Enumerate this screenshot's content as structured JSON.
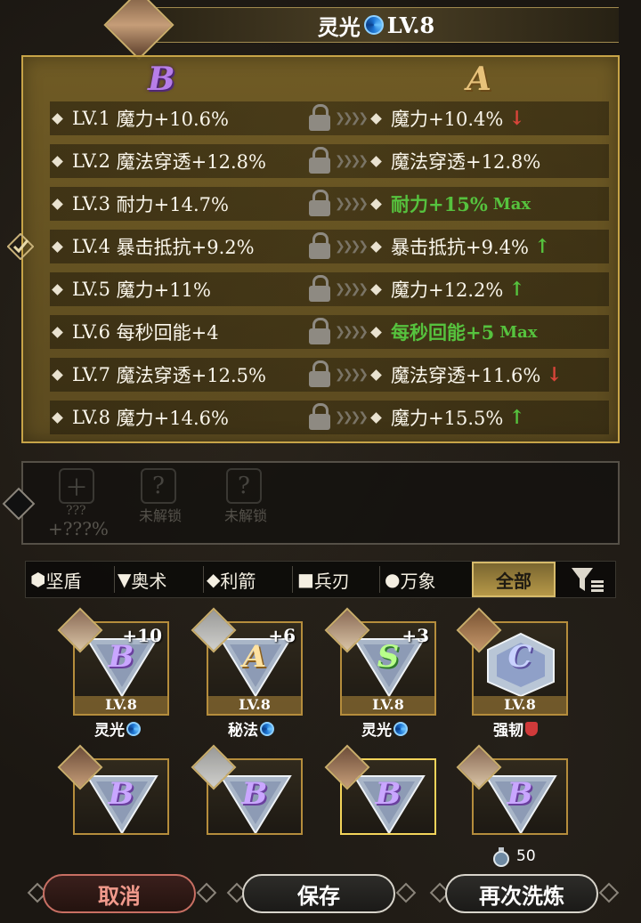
{
  "header": {
    "name": "灵光",
    "level": "LV.8",
    "icon": "aura-swirl-icon",
    "portrait": "hero-portrait"
  },
  "comparison": {
    "left_grade": "B",
    "right_grade": "A",
    "rows": [
      {
        "level": "LV.1",
        "left": "魔力+10.6%",
        "right": "魔力+10.4%",
        "trend": "down",
        "max": false
      },
      {
        "level": "LV.2",
        "left": "魔法穿透+12.8%",
        "right": "魔法穿透+12.8%",
        "trend": "none",
        "max": false
      },
      {
        "level": "LV.3",
        "left": "耐力+14.7%",
        "right": "耐力+15%",
        "trend": "none",
        "max": true
      },
      {
        "level": "LV.4",
        "left": "暴击抵抗+9.2%",
        "right": "暴击抵抗+9.4%",
        "trend": "up",
        "max": false
      },
      {
        "level": "LV.5",
        "left": "魔力+11%",
        "right": "魔力+12.2%",
        "trend": "up",
        "max": false
      },
      {
        "level": "LV.6",
        "left": "每秒回能+4",
        "right": "每秒回能+5",
        "trend": "none",
        "max": true
      },
      {
        "level": "LV.7",
        "left": "魔法穿透+12.5%",
        "right": "魔法穿透+11.6%",
        "trend": "down",
        "max": false
      },
      {
        "level": "LV.8",
        "left": "魔力+14.6%",
        "right": "魔力+15.5%",
        "trend": "up",
        "max": false
      }
    ],
    "max_label": "Max",
    "selected_row": 4,
    "colors": {
      "up": "#56c23e",
      "down": "#d9453a",
      "max": "#56c23e"
    }
  },
  "preview": {
    "slot1": {
      "icon": "plus-icon",
      "label": "???",
      "value": "+???%"
    },
    "slot2": {
      "icon": "question-icon",
      "label": "未解锁"
    },
    "slot3": {
      "icon": "question-icon",
      "label": "未解锁"
    }
  },
  "filters": {
    "tabs": [
      {
        "symbol": "⬢",
        "label": "坚盾"
      },
      {
        "symbol": "▼",
        "label": "奥术"
      },
      {
        "symbol": "◆",
        "label": "利箭"
      },
      {
        "symbol": "■",
        "label": "兵刃"
      },
      {
        "symbol": "●",
        "label": "万象"
      }
    ],
    "active_label": "全部",
    "filter_icon": "filter-sort-icon"
  },
  "gems": [
    {
      "grade": "B",
      "plus": "+10",
      "level": "LV.8",
      "name": "灵光",
      "type_icon": "aura-swirl-icon"
    },
    {
      "grade": "A",
      "plus": "+6",
      "level": "LV.8",
      "name": "秘法",
      "type_icon": "aura-swirl-icon"
    },
    {
      "grade": "S",
      "plus": "+3",
      "level": "LV.8",
      "name": "灵光",
      "type_icon": "aura-swirl-icon"
    },
    {
      "grade": "C",
      "plus": "",
      "level": "LV.8",
      "name": "强韧",
      "type_icon": "red-shield-icon"
    },
    {
      "grade": "B",
      "plus": "",
      "level": "",
      "name": ""
    },
    {
      "grade": "B",
      "plus": "",
      "level": "",
      "name": ""
    },
    {
      "grade": "B",
      "plus": "",
      "level": "",
      "name": ""
    },
    {
      "grade": "B",
      "plus": "",
      "level": "",
      "name": ""
    }
  ],
  "cost": {
    "icon": "potion-icon",
    "amount": "50"
  },
  "buttons": {
    "cancel": "取消",
    "save": "保存",
    "reroll": "再次洗炼"
  }
}
